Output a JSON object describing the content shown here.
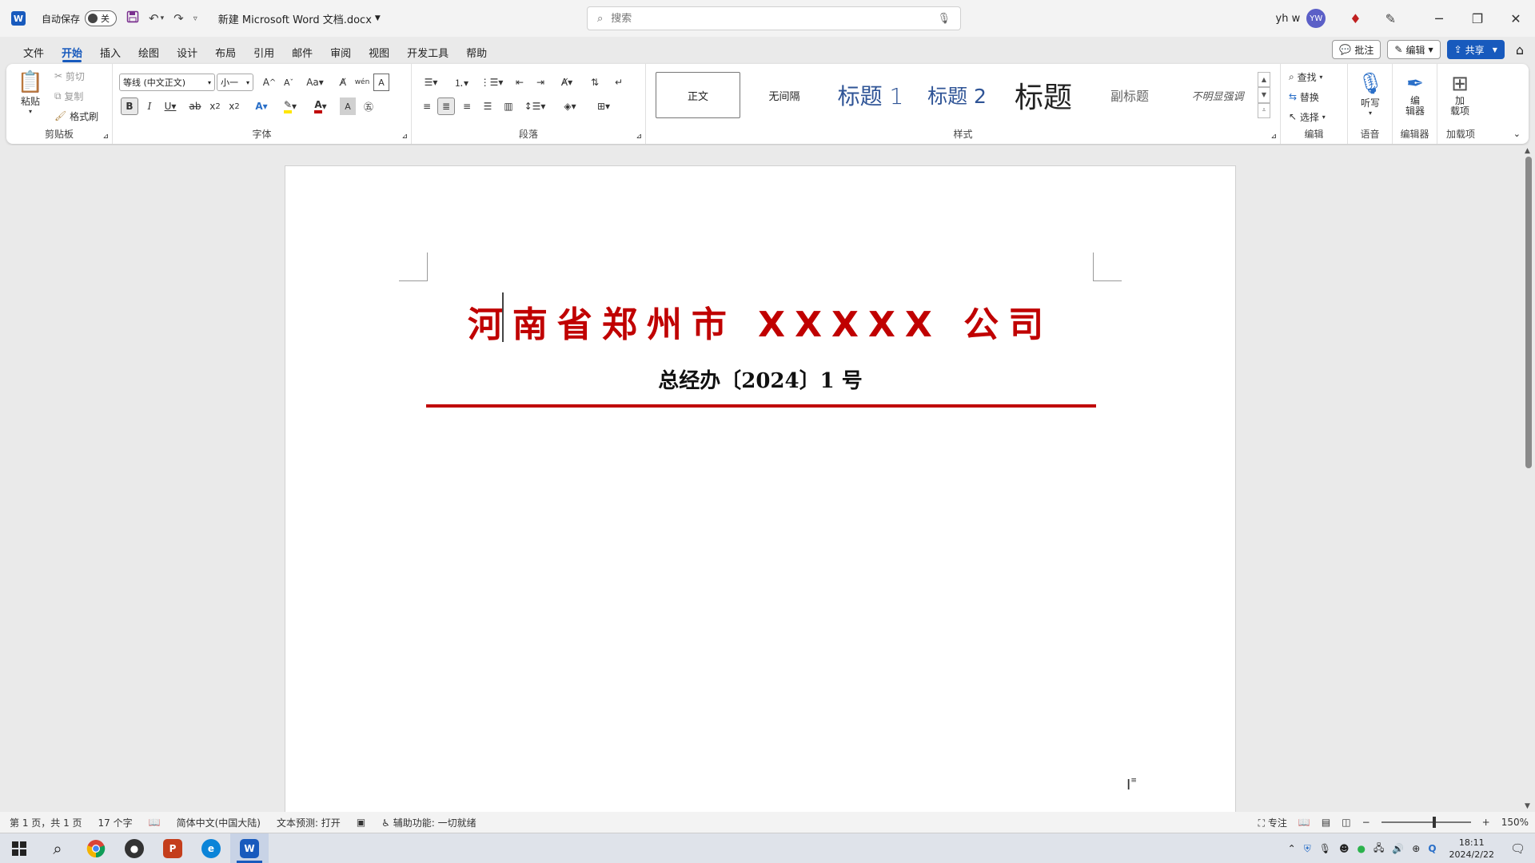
{
  "titlebar": {
    "autosave_label": "自动保存",
    "autosave_state": "关",
    "doc_title": "新建 Microsoft Word 文档.docx",
    "search_placeholder": "搜索",
    "user_name": "yh w",
    "avatar_initials": "YW"
  },
  "menu": {
    "tabs": [
      "文件",
      "开始",
      "插入",
      "绘图",
      "设计",
      "布局",
      "引用",
      "邮件",
      "审阅",
      "视图",
      "开发工具",
      "帮助"
    ],
    "active": "开始",
    "comment_label": "批注",
    "edit_label": "编辑",
    "share_label": "共享"
  },
  "ribbon": {
    "clipboard": {
      "paste": "粘贴",
      "cut": "剪切",
      "copy": "复制",
      "format_painter": "格式刷",
      "label": "剪贴板"
    },
    "font": {
      "font_name": "等线 (中文正文)",
      "font_size": "小一",
      "label": "字体"
    },
    "paragraph": {
      "label": "段落"
    },
    "styles": {
      "items": [
        "正文",
        "无间隔",
        "标题 1",
        "标题 2",
        "标题",
        "副标题",
        "不明显强调"
      ],
      "label": "样式"
    },
    "editing": {
      "find": "查找",
      "replace": "替换",
      "select": "选择",
      "label": "编辑"
    },
    "voice": {
      "dictate": "听写",
      "label": "语音"
    },
    "editor": {
      "editor": "编\n辑器",
      "label": "编辑器"
    },
    "addins": {
      "addins": "加\n载项",
      "label": "加载项"
    }
  },
  "document": {
    "heading": "河南省郑州市 XXXXX 公司",
    "subheading": "总经办〔2024〕1 号",
    "heading_color": "#c00000"
  },
  "statusbar": {
    "page": "第 1 页，共 1 页",
    "words": "17 个字",
    "language": "简体中文(中国大陆)",
    "prediction": "文本预测: 打开",
    "accessibility": "辅助功能: 一切就绪",
    "focus": "专注",
    "zoom": "150%"
  },
  "taskbar": {
    "time": "18:11",
    "date": "2024/2/22"
  },
  "colors": {
    "accent": "#185abd",
    "doc_red": "#c00000"
  }
}
